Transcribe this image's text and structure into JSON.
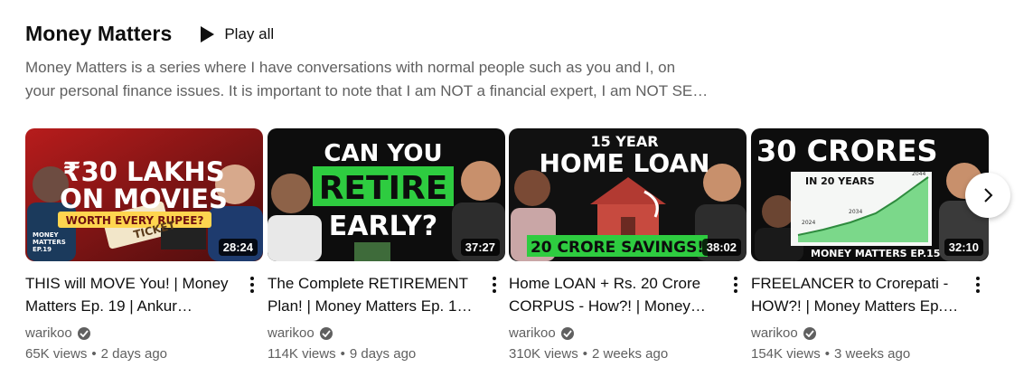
{
  "shelf": {
    "title": "Money Matters",
    "play_all": "Play all",
    "description_line1": "Money Matters is a series where I have conversations with normal people such as you and I, on",
    "description_line2": "your personal finance issues. It is important to note that I am NOT a financial expert, I am NOT SE…"
  },
  "videos": [
    {
      "title_line1": "THIS will MOVE You! | Money",
      "title_line2": "Matters Ep. 19 | Ankur…",
      "channel": "warikoo",
      "views": "65K views",
      "age": "2 days ago",
      "duration": "28:24",
      "thumb": {
        "headline1": "₹30 LAKHS",
        "headline2": "ON MOVIES",
        "tag": "WORTH EVERY RUPEE?",
        "ticket": "TICKET",
        "badge1": "MONEY",
        "badge2": "MATTERS",
        "badge3": "EP.19",
        "accent": "#c62828"
      }
    },
    {
      "title_line1": "The Complete RETIREMENT",
      "title_line2": "Plan! | Money Matters Ep. 1…",
      "channel": "warikoo",
      "views": "114K views",
      "age": "9 days ago",
      "duration": "37:27",
      "thumb": {
        "headline1": "CAN YOU",
        "headline2": "RETIRE",
        "headline3": "EARLY?",
        "accent": "#2ecc40"
      }
    },
    {
      "title_line1": "Home LOAN + Rs. 20 Crore",
      "title_line2": "CORPUS - How?! | Money…",
      "channel": "warikoo",
      "views": "310K views",
      "age": "2 weeks ago",
      "duration": "38:02",
      "thumb": {
        "headline1": "15 YEAR",
        "headline2": "HOME LOAN",
        "banner": "20 CRORE SAVINGS!",
        "accent": "#2ecc40"
      }
    },
    {
      "title_line1": "FREELANCER to Crorepati -",
      "title_line2": "HOW?! | Money Matters Ep.…",
      "channel": "warikoo",
      "views": "154K views",
      "age": "3 weeks ago",
      "duration": "32:10",
      "thumb": {
        "headline1": "30 CRORES",
        "inset": "IN 20 YEARS",
        "label_mid": "2034",
        "label_end": "2044",
        "label_start": "2024",
        "banner": "MONEY MATTERS EP.15",
        "accent": "#2ecc40"
      }
    }
  ],
  "icons": {
    "play": "play-icon",
    "verified": "verified-check-icon",
    "menu": "more-vert-icon",
    "next": "chevron-right-icon"
  },
  "colors": {
    "text_primary": "#0f0f0f",
    "text_secondary": "#606060",
    "overlay": "#000000"
  }
}
